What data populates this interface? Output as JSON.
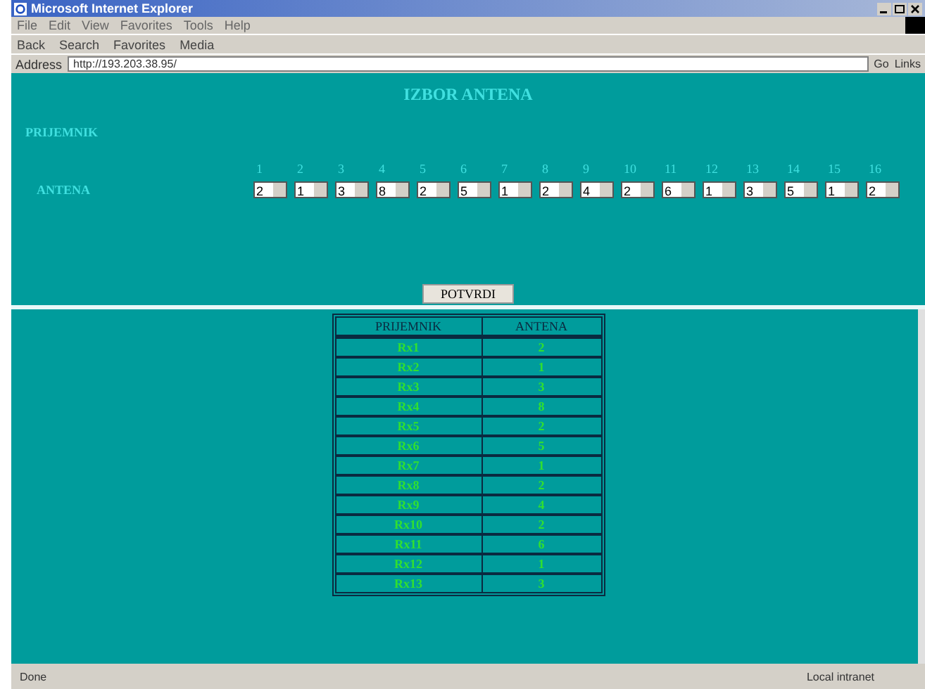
{
  "window": {
    "title": "Microsoft Internet Explorer"
  },
  "menu": [
    "File",
    "Edit",
    "View",
    "Favorites",
    "Tools",
    "Help"
  ],
  "toolbar": [
    "Back",
    "Search",
    "Favorites",
    "Media"
  ],
  "address": {
    "label": "Address",
    "value": "http://193.203.38.95/",
    "go": "Go",
    "links": "Links"
  },
  "form": {
    "title": "IZBOR ANTENA",
    "receiver_label": "PRIJEMNIK",
    "antenna_label": "ANTENA",
    "selectors": [
      {
        "number": "1",
        "value": "2"
      },
      {
        "number": "2",
        "value": "1"
      },
      {
        "number": "3",
        "value": "3"
      },
      {
        "number": "4",
        "value": "8"
      },
      {
        "number": "5",
        "value": "2"
      },
      {
        "number": "6",
        "value": "5"
      },
      {
        "number": "7",
        "value": "1"
      },
      {
        "number": "8",
        "value": "2"
      },
      {
        "number": "9",
        "value": "4"
      },
      {
        "number": "10",
        "value": "2"
      },
      {
        "number": "11",
        "value": "6"
      },
      {
        "number": "12",
        "value": "1"
      },
      {
        "number": "13",
        "value": "3"
      },
      {
        "number": "14",
        "value": "5"
      },
      {
        "number": "15",
        "value": "1"
      },
      {
        "number": "16",
        "value": "2"
      }
    ],
    "submit": "POTVRDI"
  },
  "table": {
    "columns": [
      "PRIJEMNIK",
      "ANTENA"
    ],
    "rows": [
      [
        "Rx1",
        "2"
      ],
      [
        "Rx2",
        "1"
      ],
      [
        "Rx3",
        "3"
      ],
      [
        "Rx4",
        "8"
      ],
      [
        "Rx5",
        "2"
      ],
      [
        "Rx6",
        "5"
      ],
      [
        "Rx7",
        "1"
      ],
      [
        "Rx8",
        "2"
      ],
      [
        "Rx9",
        "4"
      ],
      [
        "Rx10",
        "2"
      ],
      [
        "Rx11",
        "6"
      ],
      [
        "Rx12",
        "1"
      ],
      [
        "Rx13",
        "3"
      ]
    ]
  },
  "status_bar": {
    "text": "Done",
    "zone": "Local intranet"
  }
}
